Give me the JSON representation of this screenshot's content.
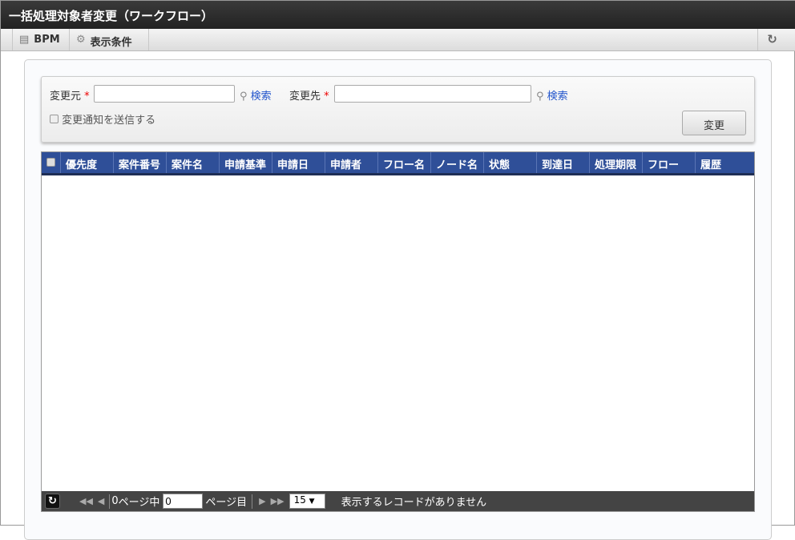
{
  "title": "一括処理対象者変更（ワークフロー）",
  "toolbar": {
    "bpm": "BPM",
    "display_conditions": "表示条件",
    "refresh_icon": "refresh-icon"
  },
  "form": {
    "from_label": "変更元",
    "from_value": "",
    "to_label": "変更先",
    "to_value": "",
    "required_mark": "*",
    "search_label": "検索",
    "notify_label": "変更通知を送信する",
    "notify_checked": false,
    "change_button": "変更"
  },
  "grid": {
    "columns": [
      "優先度",
      "案件番号",
      "案件名",
      "申請基準",
      "申請日",
      "申請者",
      "フロー名",
      "ノード名",
      "状態",
      "到達日",
      "処理期限",
      "フロー",
      "履歴"
    ],
    "rows": []
  },
  "pager": {
    "total_pages_prefix": "0",
    "of_pages": "ページ中",
    "page_value": "0",
    "page_suffix": "ページ目",
    "page_size": "15",
    "message": "表示するレコードがありません"
  }
}
